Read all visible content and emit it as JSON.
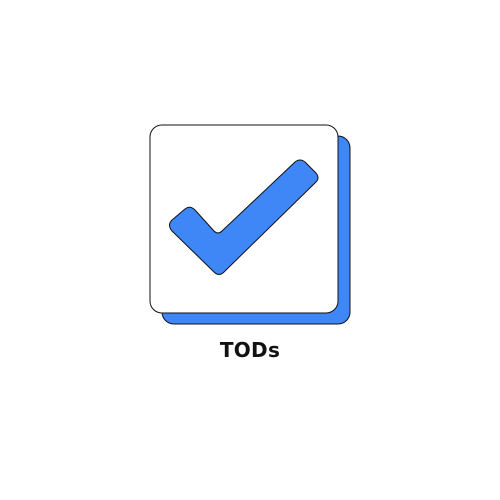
{
  "app": {
    "name": "TODs"
  },
  "logo": {
    "icon": "checkmark-icon",
    "colors": {
      "accent": "#3f86f7",
      "card": "#ffffff",
      "outline": "#111111"
    }
  }
}
